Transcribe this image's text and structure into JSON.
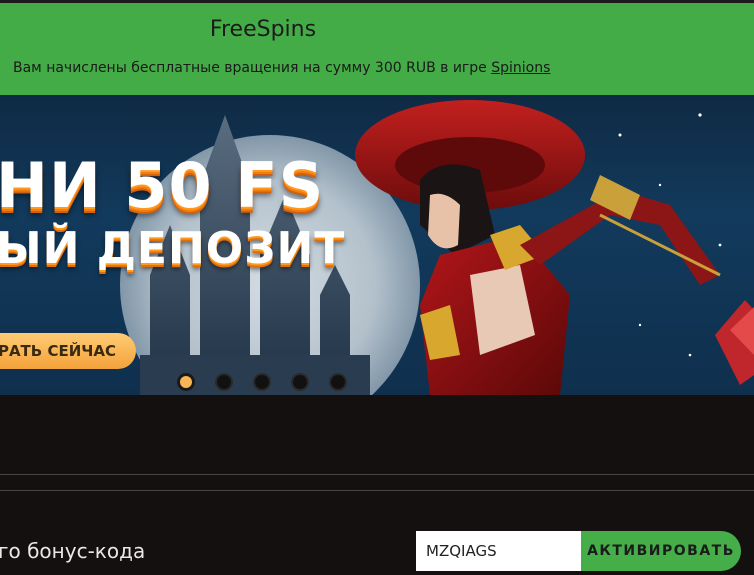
{
  "notification": {
    "title": "FreeSpins",
    "message": "Вам начислены бесплатные вращения на сумму 300 RUB в игре",
    "game_link": "Spinions"
  },
  "banner": {
    "headline_line1": "НИ 50 FS",
    "headline_line2": "ЫЙ ДЕПОЗИТ",
    "play_button": "ГРАТЬ СЕЙЧАС",
    "slides_total": 5,
    "active_slide": 1
  },
  "bonus": {
    "label": "го бонус-кода",
    "code_value": "MZQIAGS",
    "activate_label": "АКТИВИРОВАТЬ"
  },
  "colors": {
    "notification_bg": "#43ac47",
    "page_bg": "#141010",
    "accent_orange": "#f8b553",
    "button_green": "#45ae49"
  }
}
